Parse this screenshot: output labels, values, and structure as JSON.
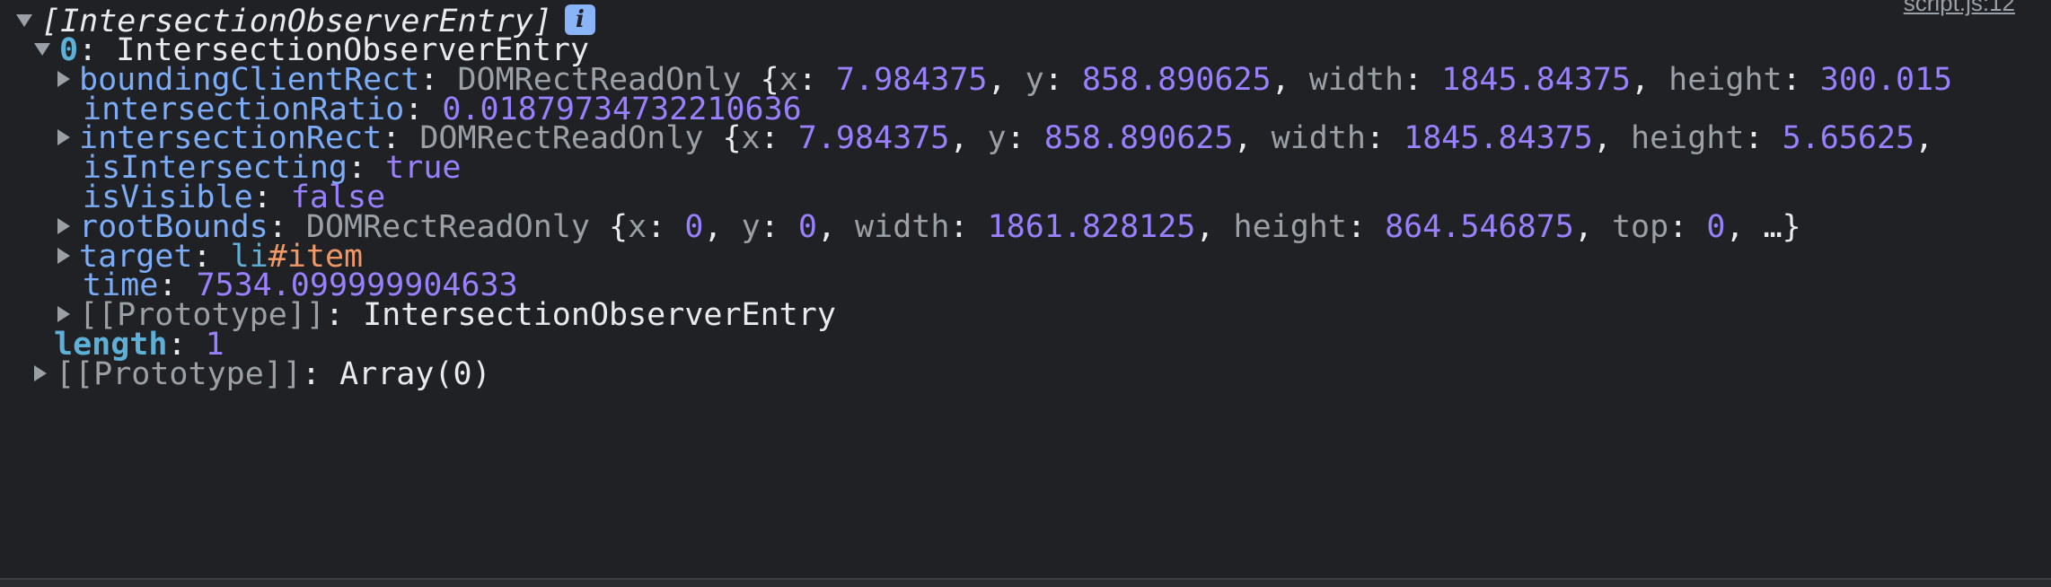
{
  "header": {
    "label": "[IntersectionObserverEntry]",
    "info": "i"
  },
  "entry0": {
    "index": "0",
    "type": "IntersectionObserverEntry"
  },
  "rows": {
    "boundingClientRect": {
      "key": "boundingClientRect",
      "type": "DOMRectReadOnly",
      "x": "7.984375",
      "y": "858.890625",
      "width": "1845.84375",
      "height": "300.015"
    },
    "intersectionRatio": {
      "key": "intersectionRatio",
      "value": "0.01879734732210636"
    },
    "intersectionRect": {
      "key": "intersectionRect",
      "type": "DOMRectReadOnly",
      "x": "7.984375",
      "y": "858.890625",
      "width": "1845.84375",
      "height": "5.65625"
    },
    "isIntersecting": {
      "key": "isIntersecting",
      "value": "true"
    },
    "isVisible": {
      "key": "isVisible",
      "value": "false"
    },
    "rootBounds": {
      "key": "rootBounds",
      "type": "DOMRectReadOnly",
      "x": "0",
      "y": "0",
      "width": "1861.828125",
      "height": "864.546875",
      "top": "0"
    },
    "target": {
      "key": "target",
      "tag": "li",
      "id": "#item"
    },
    "time": {
      "key": "time",
      "value": "7534.099999904633"
    },
    "proto": {
      "key": "[[Prototype]]",
      "value": "IntersectionObserverEntry"
    }
  },
  "length": {
    "key": "length",
    "value": "1"
  },
  "arrayProto": {
    "key": "[[Prototype]]",
    "value": "Array(0)"
  }
}
